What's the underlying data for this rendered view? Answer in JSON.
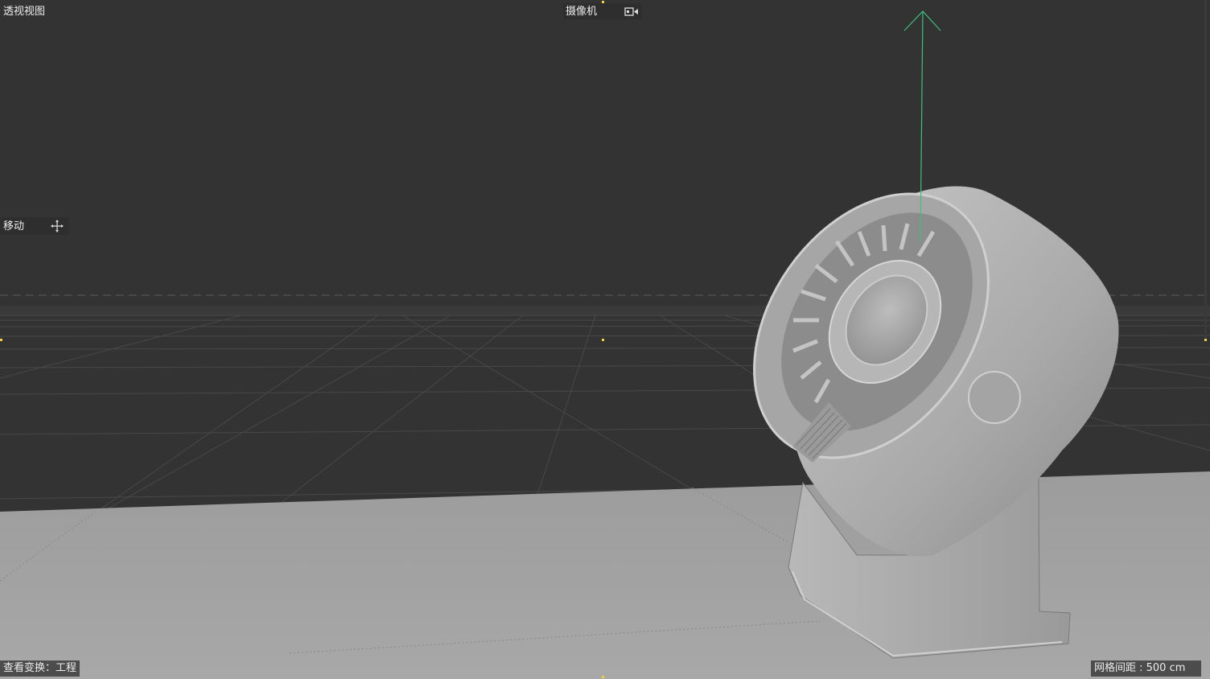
{
  "viewport": {
    "view_name": "透视视图",
    "camera_label": "摄像机",
    "tool_label": "移动",
    "view_transform": "查看变换：工程",
    "grid_spacing": "网格间距 : 500 cm"
  },
  "colors": {
    "background": "#333333",
    "floor": "#a3a3a3",
    "grid": "#4a4a4a",
    "model": "#b0b0b0",
    "axis_y": "#3fbf7f",
    "marker": "#f0d040"
  },
  "icons": {
    "camera": "camera-icon",
    "move": "move-icon",
    "axis": "y-axis-arrow"
  }
}
